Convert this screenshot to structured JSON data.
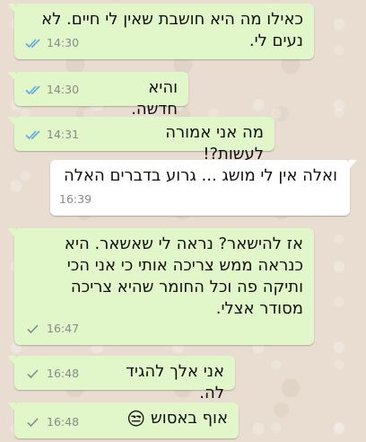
{
  "colors": {
    "outgoing_bubble": "#e1f7c9",
    "incoming_bubble": "#ffffff",
    "read_tick": "#5fa8e0",
    "sent_tick": "#8a8a8a"
  },
  "messages": [
    {
      "text": "כאילו מה היא חושבת שאין לי חיים. לא נעים לי.",
      "time": "14:30",
      "direction": "outgoing",
      "status": "read",
      "status_icon": "double-check-icon"
    },
    {
      "text": "והיא חדשה.",
      "time": "14:30",
      "direction": "outgoing",
      "status": "read",
      "status_icon": "double-check-icon"
    },
    {
      "text": "מה אני אמורה לעשות?!",
      "time": "14:31",
      "direction": "outgoing",
      "status": "read",
      "status_icon": "double-check-icon"
    },
    {
      "text": "ואלה אין לי מושג ... גרוע בדברים האלה",
      "time": "16:39",
      "direction": "incoming"
    },
    {
      "text": "אז להישאר? נראה לי שאשאר. היא כנראה ממש צריכה אותי כי אני הכי ותיקה פה וכל החומר שהיא צריכה מסודר אצלי.",
      "time": "16:47",
      "direction": "outgoing",
      "status": "sent",
      "status_icon": "single-check-icon"
    },
    {
      "text": "אני אלך להגיד לה.",
      "time": "16:48",
      "direction": "outgoing",
      "status": "sent",
      "status_icon": "single-check-icon"
    },
    {
      "text": "אוף באסוש",
      "emoji": "😒",
      "time": "16:48",
      "direction": "outgoing",
      "status": "sent",
      "status_icon": "single-check-icon"
    }
  ]
}
